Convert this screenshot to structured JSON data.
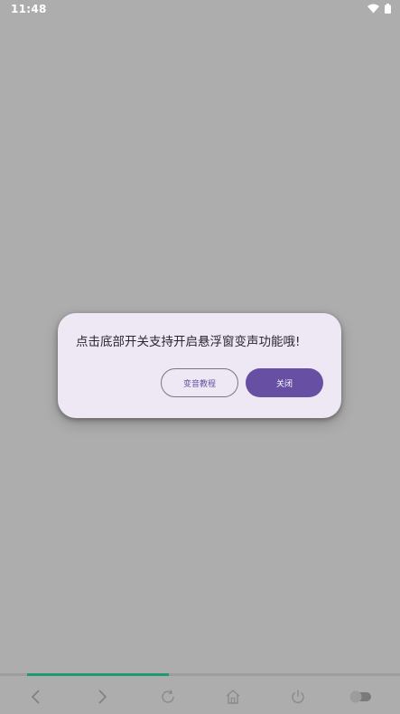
{
  "status_bar": {
    "time": "11:48",
    "icons": [
      "wifi-icon",
      "battery-icon"
    ]
  },
  "dialog": {
    "message": "点击底部开关支持开启悬浮窗变声功能哦!",
    "tutorial_button_label": "变音教程",
    "close_button_label": "关闭"
  },
  "bottom_bar": {
    "progress": 0.355,
    "icons": [
      "back-arrow-icon",
      "forward-arrow-icon",
      "refresh-icon",
      "home-icon",
      "power-icon",
      "toggle-icon"
    ]
  },
  "colors": {
    "background": "#adadad",
    "dialog_background": "#eee8f4",
    "accent": "#6750a4",
    "progress": "#1e9a6e"
  }
}
